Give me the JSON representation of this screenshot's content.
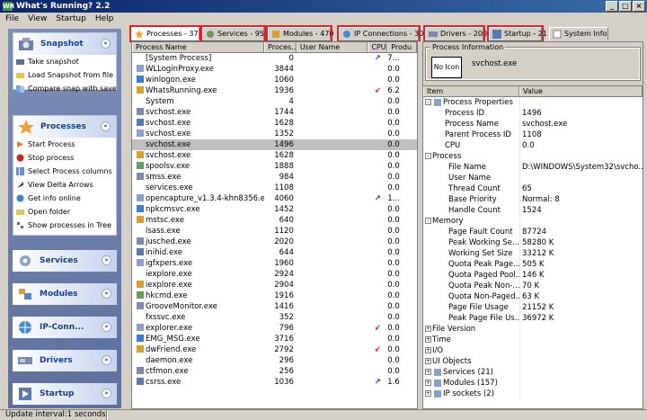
{
  "window": {
    "title": "What's Running? 2.2",
    "app_icon": "WR"
  },
  "titlebar_buttons": [
    "_",
    "□",
    "×"
  ],
  "menu": [
    "File",
    "View",
    "Startup",
    "Help"
  ],
  "groups": {
    "snapshot": {
      "title": "Snapshot",
      "items": [
        "Take snapshot",
        "Load Snapshot from file",
        "Compare snap with save..."
      ]
    },
    "processes": {
      "title": "Processes",
      "items": [
        "Start Process",
        "Stop process",
        "Select Process columns",
        "View Delta Arrows",
        "Get info online",
        "Open folder",
        "Show processes in Tree"
      ]
    },
    "services": {
      "title": "Services"
    },
    "modules": {
      "title": "Modules"
    },
    "ipconn": {
      "title": "IP-Conn..."
    },
    "drivers": {
      "title": "Drivers"
    },
    "startup": {
      "title": "Startup"
    }
  },
  "chev_expanded": "«",
  "chev_collapsed": "»",
  "tabs": [
    "Processes - 37",
    "Services - 95",
    "Modules - 470",
    "IP Connections - 30",
    "Drivers - 200",
    "Startup - 21",
    "System Info"
  ],
  "proc_columns": [
    "Process Name",
    "Proces...",
    "User Name",
    "CPU",
    "Produ"
  ],
  "processes": [
    {
      "name": "[System Process]",
      "pid": "0",
      "cpu": "arrow-up",
      "prod": "7..."
    },
    {
      "name": "WLLoginProxy.exe",
      "pid": "3844",
      "cpu": "",
      "prod": "0.0"
    },
    {
      "name": "winlogon.exe",
      "pid": "1060",
      "cpu": "",
      "prod": "0.0"
    },
    {
      "name": "WhatsRunning.exe",
      "pid": "1936",
      "cpu": "arrow-down",
      "prod": "6.2"
    },
    {
      "name": "System",
      "pid": "4",
      "cpu": "",
      "prod": "0.0"
    },
    {
      "name": "svchost.exe",
      "pid": "1744",
      "cpu": "",
      "prod": "0.0"
    },
    {
      "name": "svchost.exe",
      "pid": "1628",
      "cpu": "",
      "prod": "0.0"
    },
    {
      "name": "svchost.exe",
      "pid": "1352",
      "cpu": "",
      "prod": "0.0"
    },
    {
      "name": "svchost.exe",
      "pid": "1496",
      "cpu": "",
      "prod": "0.0",
      "selected": true
    },
    {
      "name": "svchost.exe",
      "pid": "1628",
      "cpu": "",
      "prod": "0.0"
    },
    {
      "name": "spoolsv.exe",
      "pid": "1888",
      "cpu": "",
      "prod": "0.0"
    },
    {
      "name": "smss.exe",
      "pid": "984",
      "cpu": "",
      "prod": "0.0"
    },
    {
      "name": "services.exe",
      "pid": "1108",
      "cpu": "",
      "prod": "0.0"
    },
    {
      "name": "opencapture_v1.3.4-khn8356.exe",
      "pid": "4060",
      "cpu": "arrow-up",
      "prod": "1..."
    },
    {
      "name": "npkcmsvc.exe",
      "pid": "1452",
      "cpu": "",
      "prod": "0.0"
    },
    {
      "name": "mstsc.exe",
      "pid": "640",
      "cpu": "",
      "prod": "0.0"
    },
    {
      "name": "lsass.exe",
      "pid": "1120",
      "cpu": "",
      "prod": "0.0"
    },
    {
      "name": "jusched.exe",
      "pid": "2020",
      "cpu": "",
      "prod": "0.0"
    },
    {
      "name": "inihid.exe",
      "pid": "644",
      "cpu": "",
      "prod": "0.0"
    },
    {
      "name": "igfxpers.exe",
      "pid": "1960",
      "cpu": "",
      "prod": "0.0"
    },
    {
      "name": "iexplore.exe",
      "pid": "2924",
      "cpu": "",
      "prod": "0.0"
    },
    {
      "name": "iexplore.exe",
      "pid": "2904",
      "cpu": "",
      "prod": "0.0"
    },
    {
      "name": "hkcmd.exe",
      "pid": "1916",
      "cpu": "",
      "prod": "0.0"
    },
    {
      "name": "GrooveMonitor.exe",
      "pid": "1416",
      "cpu": "",
      "prod": "0.0"
    },
    {
      "name": "fxssvc.exe",
      "pid": "352",
      "cpu": "",
      "prod": "0.0"
    },
    {
      "name": "explorer.exe",
      "pid": "796",
      "cpu": "arrow-down",
      "prod": "0.0"
    },
    {
      "name": "EMG_MSG.exe",
      "pid": "3716",
      "cpu": "",
      "prod": "0.0"
    },
    {
      "name": "dwFriend.exe",
      "pid": "2792",
      "cpu": "arrow-down",
      "prod": "0.0"
    },
    {
      "name": "daemon.exe",
      "pid": "296",
      "cpu": "",
      "prod": "0.0"
    },
    {
      "name": "ctfmon.exe",
      "pid": "256",
      "cpu": "",
      "prod": "0.0"
    },
    {
      "name": "csrss.exe",
      "pid": "1036",
      "cpu": "arrow-up",
      "prod": "1.6"
    }
  ],
  "info": {
    "label": "Process Information",
    "no_icon": "No Icon",
    "name": "svchost.exe"
  },
  "prop_columns": [
    "Item",
    "Value"
  ],
  "properties": [
    {
      "level": 0,
      "expander": "-",
      "key": "Process Properties",
      "value": "",
      "icon": "gear-icon"
    },
    {
      "level": 1,
      "key": "Process ID",
      "value": "1496"
    },
    {
      "level": 1,
      "key": "Process Name",
      "value": "svchost.exe"
    },
    {
      "level": 1,
      "key": "Parent Process ID",
      "value": "1108"
    },
    {
      "level": 1,
      "key": "CPU",
      "value": "0.0"
    },
    {
      "level": 0,
      "expander": "-",
      "key": "Process",
      "value": ""
    },
    {
      "level": 2,
      "key": "File Name",
      "value": "D:\\WINDOWS\\System32\\svcho..."
    },
    {
      "level": 2,
      "key": "User Name",
      "value": ""
    },
    {
      "level": 2,
      "key": "Thread Count",
      "value": "65"
    },
    {
      "level": 2,
      "key": "Base Priority",
      "value": "Normal: 8"
    },
    {
      "level": 2,
      "key": "Handle Count",
      "value": "1524"
    },
    {
      "level": 0,
      "expander": "-",
      "key": "Memory",
      "value": ""
    },
    {
      "level": 2,
      "key": "Page Fault Count",
      "value": "87724"
    },
    {
      "level": 2,
      "key": "Peak Working Se...",
      "value": "58280 K"
    },
    {
      "level": 2,
      "key": "Working Set Size",
      "value": "33212 K"
    },
    {
      "level": 2,
      "key": "Quota Peak Page...",
      "value": "505 K"
    },
    {
      "level": 2,
      "key": "Quota Paged Pool...",
      "value": "146 K"
    },
    {
      "level": 2,
      "key": "Quota Peak Non-...",
      "value": "70 K"
    },
    {
      "level": 2,
      "key": "Quota Non-Paged...",
      "value": "63 K"
    },
    {
      "level": 2,
      "key": "Page File Usage",
      "value": "21152 K"
    },
    {
      "level": 2,
      "key": "Peak Page File Us...",
      "value": "36972 K"
    },
    {
      "level": 0,
      "expander": "+",
      "key": "File Version",
      "value": ""
    },
    {
      "level": 0,
      "expander": "+",
      "key": "Time",
      "value": ""
    },
    {
      "level": 0,
      "expander": "+",
      "key": "I/O",
      "value": ""
    },
    {
      "level": 0,
      "expander": "+",
      "key": "UI Objects",
      "value": ""
    },
    {
      "level": 0,
      "expander": "+",
      "key": "Services (21)",
      "value": "",
      "icon": "gear-icon"
    },
    {
      "level": 0,
      "expander": "+",
      "key": "Modules (157)",
      "value": "",
      "icon": "module-icon"
    },
    {
      "level": 0,
      "expander": "+",
      "key": "IP sockets (2)",
      "value": "",
      "icon": "network-icon"
    }
  ],
  "status": {
    "text": "Update interval:1 seconds"
  },
  "colors": {
    "highlight": "#e0202a",
    "sidebar": "#5d6f9c",
    "title": "#0a246a"
  }
}
